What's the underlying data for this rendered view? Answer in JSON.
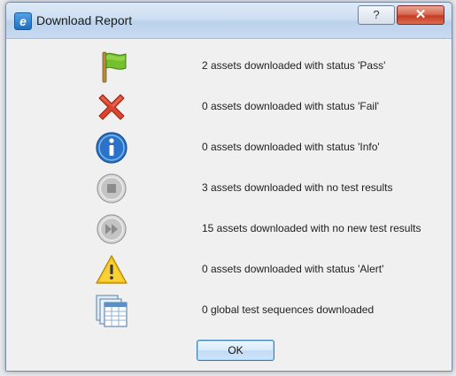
{
  "window": {
    "title": "Download Report",
    "app_icon": "app-e-icon",
    "app_icon_glyph": "e",
    "help_glyph": "?",
    "close_glyph": "✕"
  },
  "rows": [
    {
      "icon": "green-flag-icon",
      "text": "2 assets downloaded with status 'Pass'"
    },
    {
      "icon": "red-x-icon",
      "text": "0 assets downloaded with status 'Fail'"
    },
    {
      "icon": "info-icon",
      "text": "0 assets downloaded with status 'Info'"
    },
    {
      "icon": "stop-circle-icon",
      "text": "3 assets downloaded with no test results"
    },
    {
      "icon": "fast-forward-circle-icon",
      "text": "15 assets downloaded with no new test results"
    },
    {
      "icon": "warning-triangle-icon",
      "text": "0 assets downloaded with status 'Alert'"
    },
    {
      "icon": "sequences-icon",
      "text": "0 global test sequences downloaded"
    }
  ],
  "buttons": {
    "ok_label": "OK"
  },
  "colors": {
    "pass": "#6fb827",
    "fail": "#d9442f",
    "info": "#2a73c8",
    "neutral": "#b8b8b8",
    "alert": "#f2c21c",
    "button_border": "#3c7fb1"
  }
}
